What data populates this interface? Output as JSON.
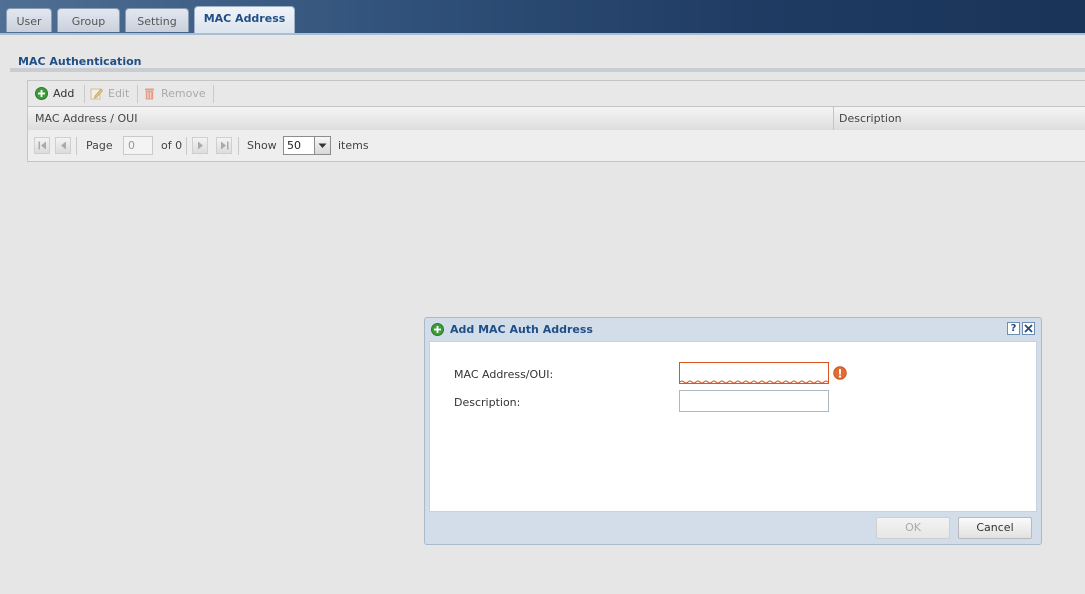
{
  "tabs": [
    {
      "label": "User",
      "active": false
    },
    {
      "label": "Group",
      "active": false
    },
    {
      "label": "Setting",
      "active": false
    },
    {
      "label": "MAC Address",
      "active": true
    }
  ],
  "section": {
    "title": "MAC Authentication"
  },
  "toolbar": {
    "add_label": "Add",
    "edit_label": "Edit",
    "remove_label": "Remove"
  },
  "table": {
    "columns": [
      "MAC Address / OUI",
      "Description"
    ],
    "rows": []
  },
  "pager": {
    "page_label": "Page",
    "page_value": "0",
    "of_label": "of 0",
    "show_label": "Show",
    "show_value": "50",
    "items_label": "items"
  },
  "dialog": {
    "title": "Add MAC Auth Address",
    "help_label": "?",
    "mac_label": "MAC Address/OUI:",
    "mac_value": "",
    "description_label": "Description:",
    "description_value": "",
    "ok_label": "OK",
    "cancel_label": "Cancel"
  },
  "colors": {
    "accent": "#1f4f86",
    "error": "#d9541f",
    "add_green": "#3c9c3a"
  }
}
